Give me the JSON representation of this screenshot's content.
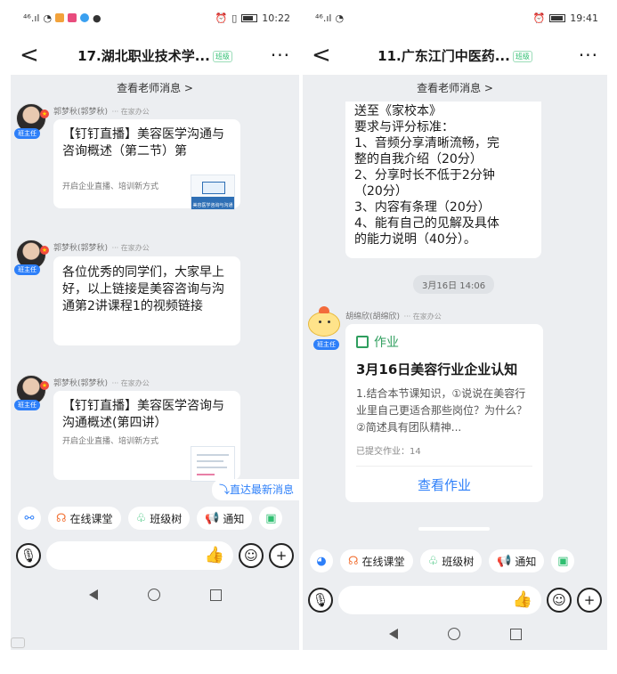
{
  "left": {
    "status": {
      "signal": "⁴⁶.ıl",
      "time": "10:22",
      "alarm_icon": "alarm-icon"
    },
    "header": {
      "back": "<",
      "title": "17.湖北职业技术学...",
      "badge": "班级",
      "more": "···"
    },
    "teacher_messages": "查看老师消息 >",
    "messages": [
      {
        "sender": "郭梦秋(郭梦秋)",
        "location": "在家办公",
        "role": "班主任",
        "title": "【钉钉直播】美容医学沟通与咨询概述（第二节）第",
        "subtitle": "开启企业直播、培训新方式",
        "thumb_caption": "美容医学咨询与沟通"
      },
      {
        "sender": "郭梦秋(郭梦秋)",
        "location": "在家办公",
        "role": "班主任",
        "text": "各位优秀的同学们，大家早上好，以上链接是美容咨询与沟通第2讲课程1的视频链接"
      },
      {
        "sender": "郭梦秋(郭梦秋)",
        "location": "在家办公",
        "role": "班主任",
        "title": "【钉钉直播】美容医学咨询与沟通概述(第四讲）",
        "subtitle": "开启企业直播、培训新方式"
      }
    ],
    "jump_latest": "直达最新消息",
    "quick_actions": [
      "在线课堂",
      "班级树",
      "通知"
    ],
    "nav": {
      "back": "◁",
      "home": "○",
      "recent": "□"
    }
  },
  "right": {
    "status": {
      "signal": "⁴⁶.ıl",
      "time": "19:41"
    },
    "header": {
      "back": "<",
      "title": "11.广东江门中医药...",
      "badge": "班级",
      "more": "···"
    },
    "teacher_messages": "查看老师消息 >",
    "prev_message_lines": [
      "送至《家校本》",
      "要求与评分标准：",
      "1、音频分享清晰流畅，完",
      "整的自我介绍（20分）",
      "2、分享时长不低于2分钟",
      "（20分）",
      "3、内容有条理（20分）",
      "4、能有自己的见解及具体",
      "的能力说明（40分）。"
    ],
    "timestamp": "3月16日 14:06",
    "homework": {
      "sender": "胡绵欣(胡绵欣)",
      "location": "在家办公",
      "role": "班主任",
      "tag": "作业",
      "title": "3月16日美容行业企业认知",
      "desc": "1.结合本节课知识，①说说在美容行业里自己更适合那些岗位？为什么？②简述具有团队精神...",
      "submitted": "已提交作业：14",
      "button": "查看作业"
    },
    "quick_actions": [
      "在线课堂",
      "班级树",
      "通知"
    ],
    "nav": {
      "back": "◁",
      "home": "○",
      "recent": "□"
    }
  }
}
